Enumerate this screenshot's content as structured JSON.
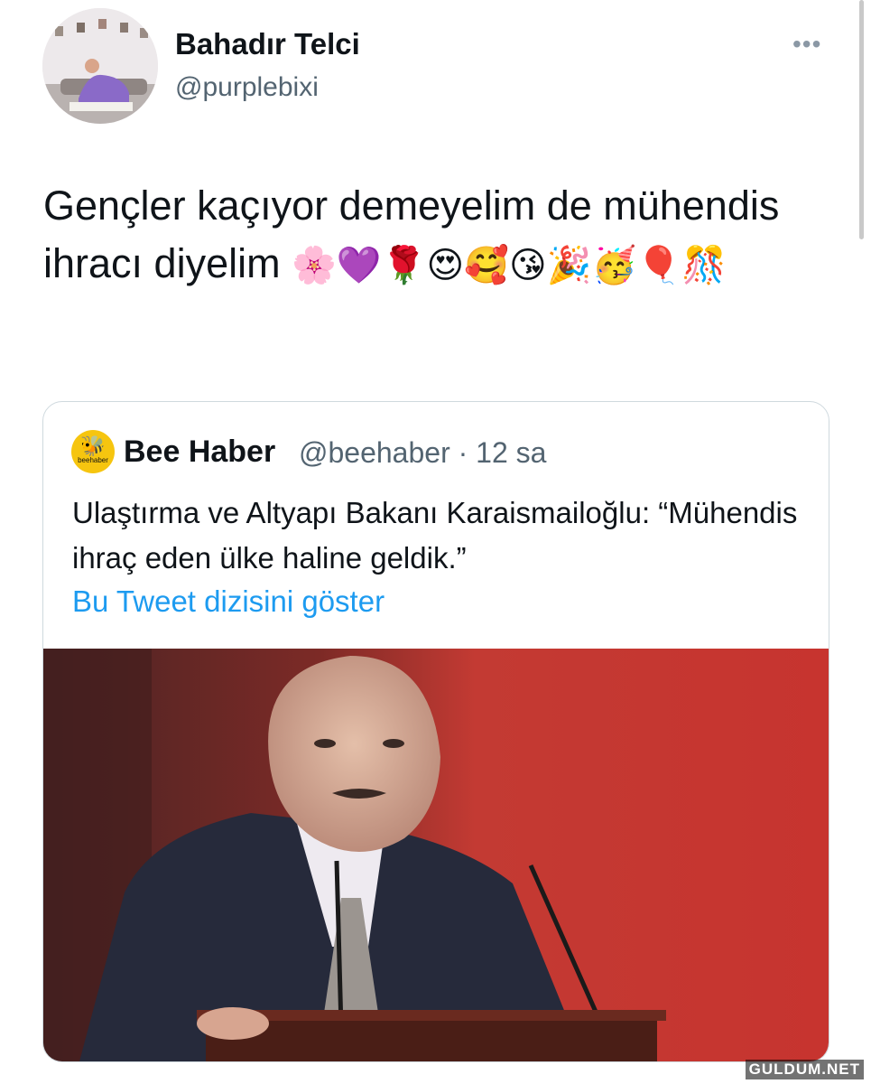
{
  "author": {
    "name": "Bahadır Telci",
    "handle": "@purplebixi",
    "more_icon": "more-dots-icon"
  },
  "tweet": {
    "text": "Gençler kaçıyor demeyelim de mühendis ihracı diyelim",
    "emojis": "🌸💜🌹😍🥰😘🎉🥳🎈🎊"
  },
  "quote": {
    "logo_text": "beehaber",
    "name": "Bee Haber",
    "handle": "@beehaber",
    "time": "· 12 sa",
    "text": "Ulaştırma ve Altyapı Bakanı Karaismailoğlu: “Mühendis ihraç eden ülke haline geldik.”",
    "link": "Bu Tweet dizisini göster"
  },
  "watermark": "GULDUM.NET",
  "colors": {
    "link": "#1d9bf0",
    "secondary_text": "#536471",
    "border": "#cfd9de",
    "background_red": "#c8322e"
  }
}
